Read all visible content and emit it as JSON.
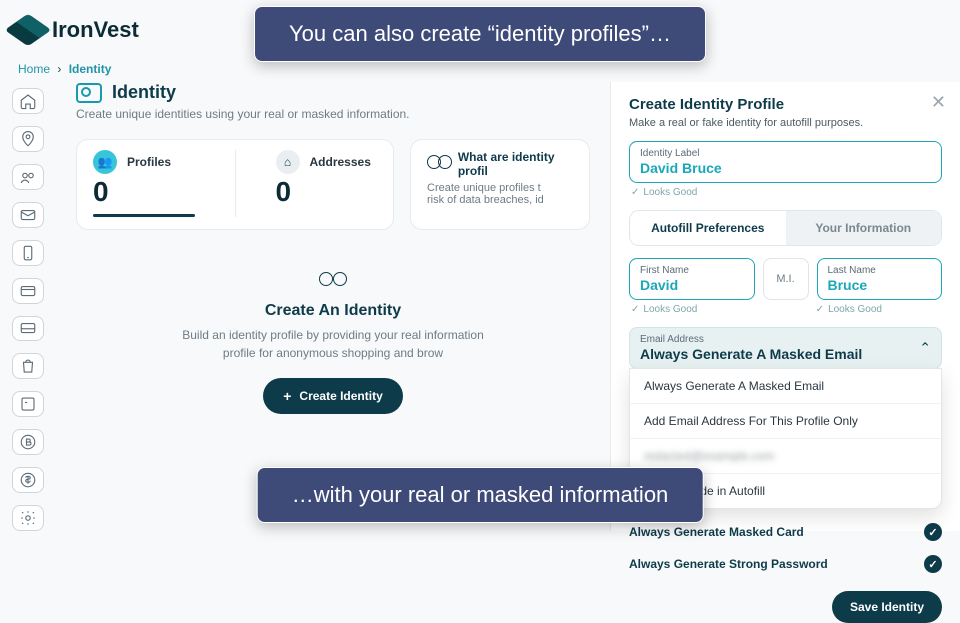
{
  "brand": "IronVest",
  "breadcrumb": {
    "home": "Home",
    "current": "Identity"
  },
  "page": {
    "title": "Identity",
    "subtitle": "Create unique identities using your real or masked information."
  },
  "stats": {
    "profiles_label": "Profiles",
    "profiles_value": "0",
    "addresses_label": "Addresses",
    "addresses_value": "0"
  },
  "explain": {
    "heading": "What are identity profil",
    "body": "Create unique profiles t\nrisk of data breaches, id"
  },
  "cta": {
    "heading": "Create An Identity",
    "body": "Build an identity profile by providing your real information\nprofile for anonymous shopping and brow",
    "button": "Create Identity"
  },
  "drawer": {
    "title": "Create Identity Profile",
    "subtitle": "Make a real or fake identity for autofill purposes.",
    "identity_label_label": "Identity Label",
    "identity_label_value": "David Bruce",
    "looks_good": "Looks Good",
    "tab_autofill": "Autofill Preferences",
    "tab_yourinfo": "Your Information",
    "first_name_label": "First Name",
    "first_name_value": "David",
    "mi_label": "M.I.",
    "last_name_label": "Last Name",
    "last_name_value": "Bruce",
    "email_field_label": "Email Address",
    "email_field_value": "Always Generate A Masked Email",
    "options": [
      "Always Generate A Masked Email",
      "Add Email Address For This Profile Only",
      "redacted@example.com",
      "Don't Include in Autofill"
    ],
    "toggle_card": "Always Generate Masked Card",
    "toggle_password": "Always Generate Strong Password",
    "save": "Save Identity"
  },
  "annotations": {
    "top": "You can also create “identity profiles”…",
    "bottom": "…with your real or masked information"
  }
}
